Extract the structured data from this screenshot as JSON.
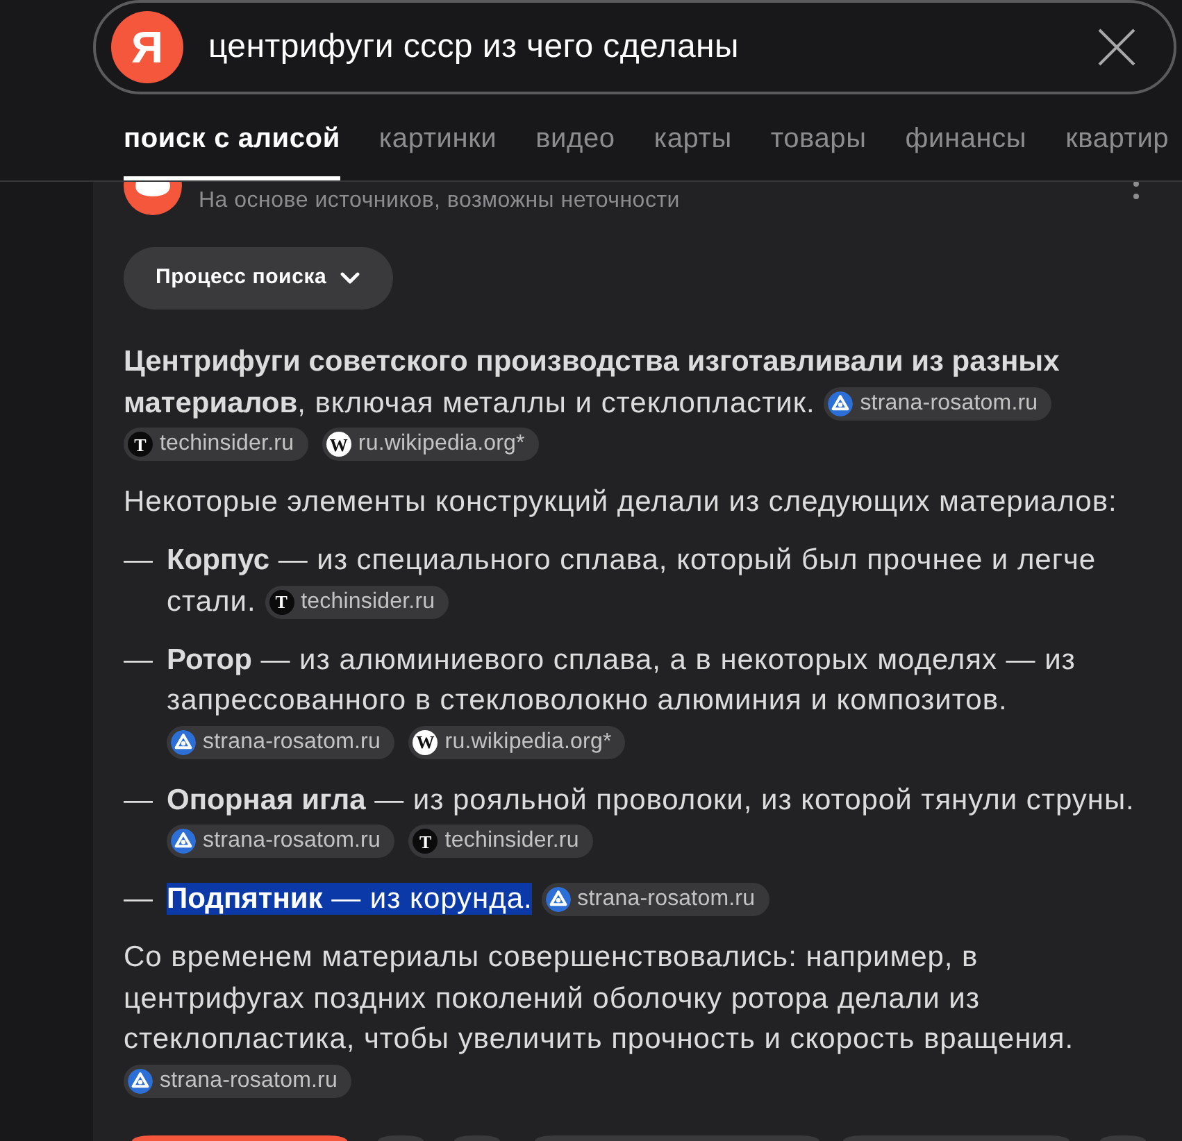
{
  "search": {
    "logo": "Я",
    "value": "центрифуги ссср из чего сделаны"
  },
  "tabs": [
    {
      "label": "поиск с алисой",
      "selected": true
    },
    {
      "label": "картинки",
      "selected": false
    },
    {
      "label": "видео",
      "selected": false
    },
    {
      "label": "карты",
      "selected": false
    },
    {
      "label": "товары",
      "selected": false
    },
    {
      "label": "финансы",
      "selected": false
    },
    {
      "label": "квартир",
      "selected": false
    }
  ],
  "answer": {
    "disclaimer": "На основе источников, возможны неточности",
    "process_button": "Процесс поиска",
    "blocks": [
      {
        "kind": "paragraph",
        "highlighted": false,
        "text": "**Центрифуги советского производства изготавливали из разных материалов**, включая металлы и стеклопластик.",
        "sources": [
          {
            "kind": "emblem",
            "label": "strana-rosatom.ru"
          },
          {
            "kind": "dark",
            "icon_text": "T",
            "label": "techinsider.ru"
          },
          {
            "kind": "light",
            "icon_text": "W",
            "label": "ru.wikipedia.org*"
          }
        ]
      },
      {
        "kind": "paragraph",
        "highlighted": false,
        "text": "Некоторые элементы конструкций делали из следующих материалов:"
      },
      {
        "kind": "item",
        "marker": "—",
        "highlighted": false,
        "text": "**Корпус** — из специального сплава, который был прочнее и легче стали.",
        "sources": [
          {
            "kind": "dark",
            "icon_text": "T",
            "label": "techinsider.ru"
          }
        ]
      },
      {
        "kind": "item",
        "marker": "—",
        "highlighted": false,
        "text": "**Ротор** — из алюминиевого сплава, а в некоторых моделях — из запрессованного в стекловолокно алюминия и композитов.",
        "sources": [
          {
            "kind": "emblem",
            "label": "strana-rosatom.ru"
          },
          {
            "kind": "light",
            "icon_text": "W",
            "label": "ru.wikipedia.org*"
          }
        ]
      },
      {
        "kind": "item",
        "marker": "—",
        "highlighted": false,
        "text": "**Опорная игла** — из рояльной проволоки, из которой тянули струны.",
        "sources": [
          {
            "kind": "emblem",
            "label": "strana-rosatom.ru"
          },
          {
            "kind": "dark",
            "icon_text": "T",
            "label": "techinsider.ru"
          }
        ]
      },
      {
        "kind": "item",
        "marker": "—",
        "highlighted": true,
        "text": "**Подпятник** — из корунда.",
        "sources": [
          {
            "kind": "emblem",
            "label": "strana-rosatom.ru"
          }
        ]
      },
      {
        "kind": "paragraph",
        "highlighted": false,
        "text": "Со временем материалы совершенствовались: например, в центрифугах поздних поколений оболочку ротора делали из стеклопластика, чтобы увеличить прочность и скорость вращения.",
        "sources": [
          {
            "kind": "emblem",
            "label": "strana-rosatom.ru"
          }
        ]
      }
    ]
  }
}
